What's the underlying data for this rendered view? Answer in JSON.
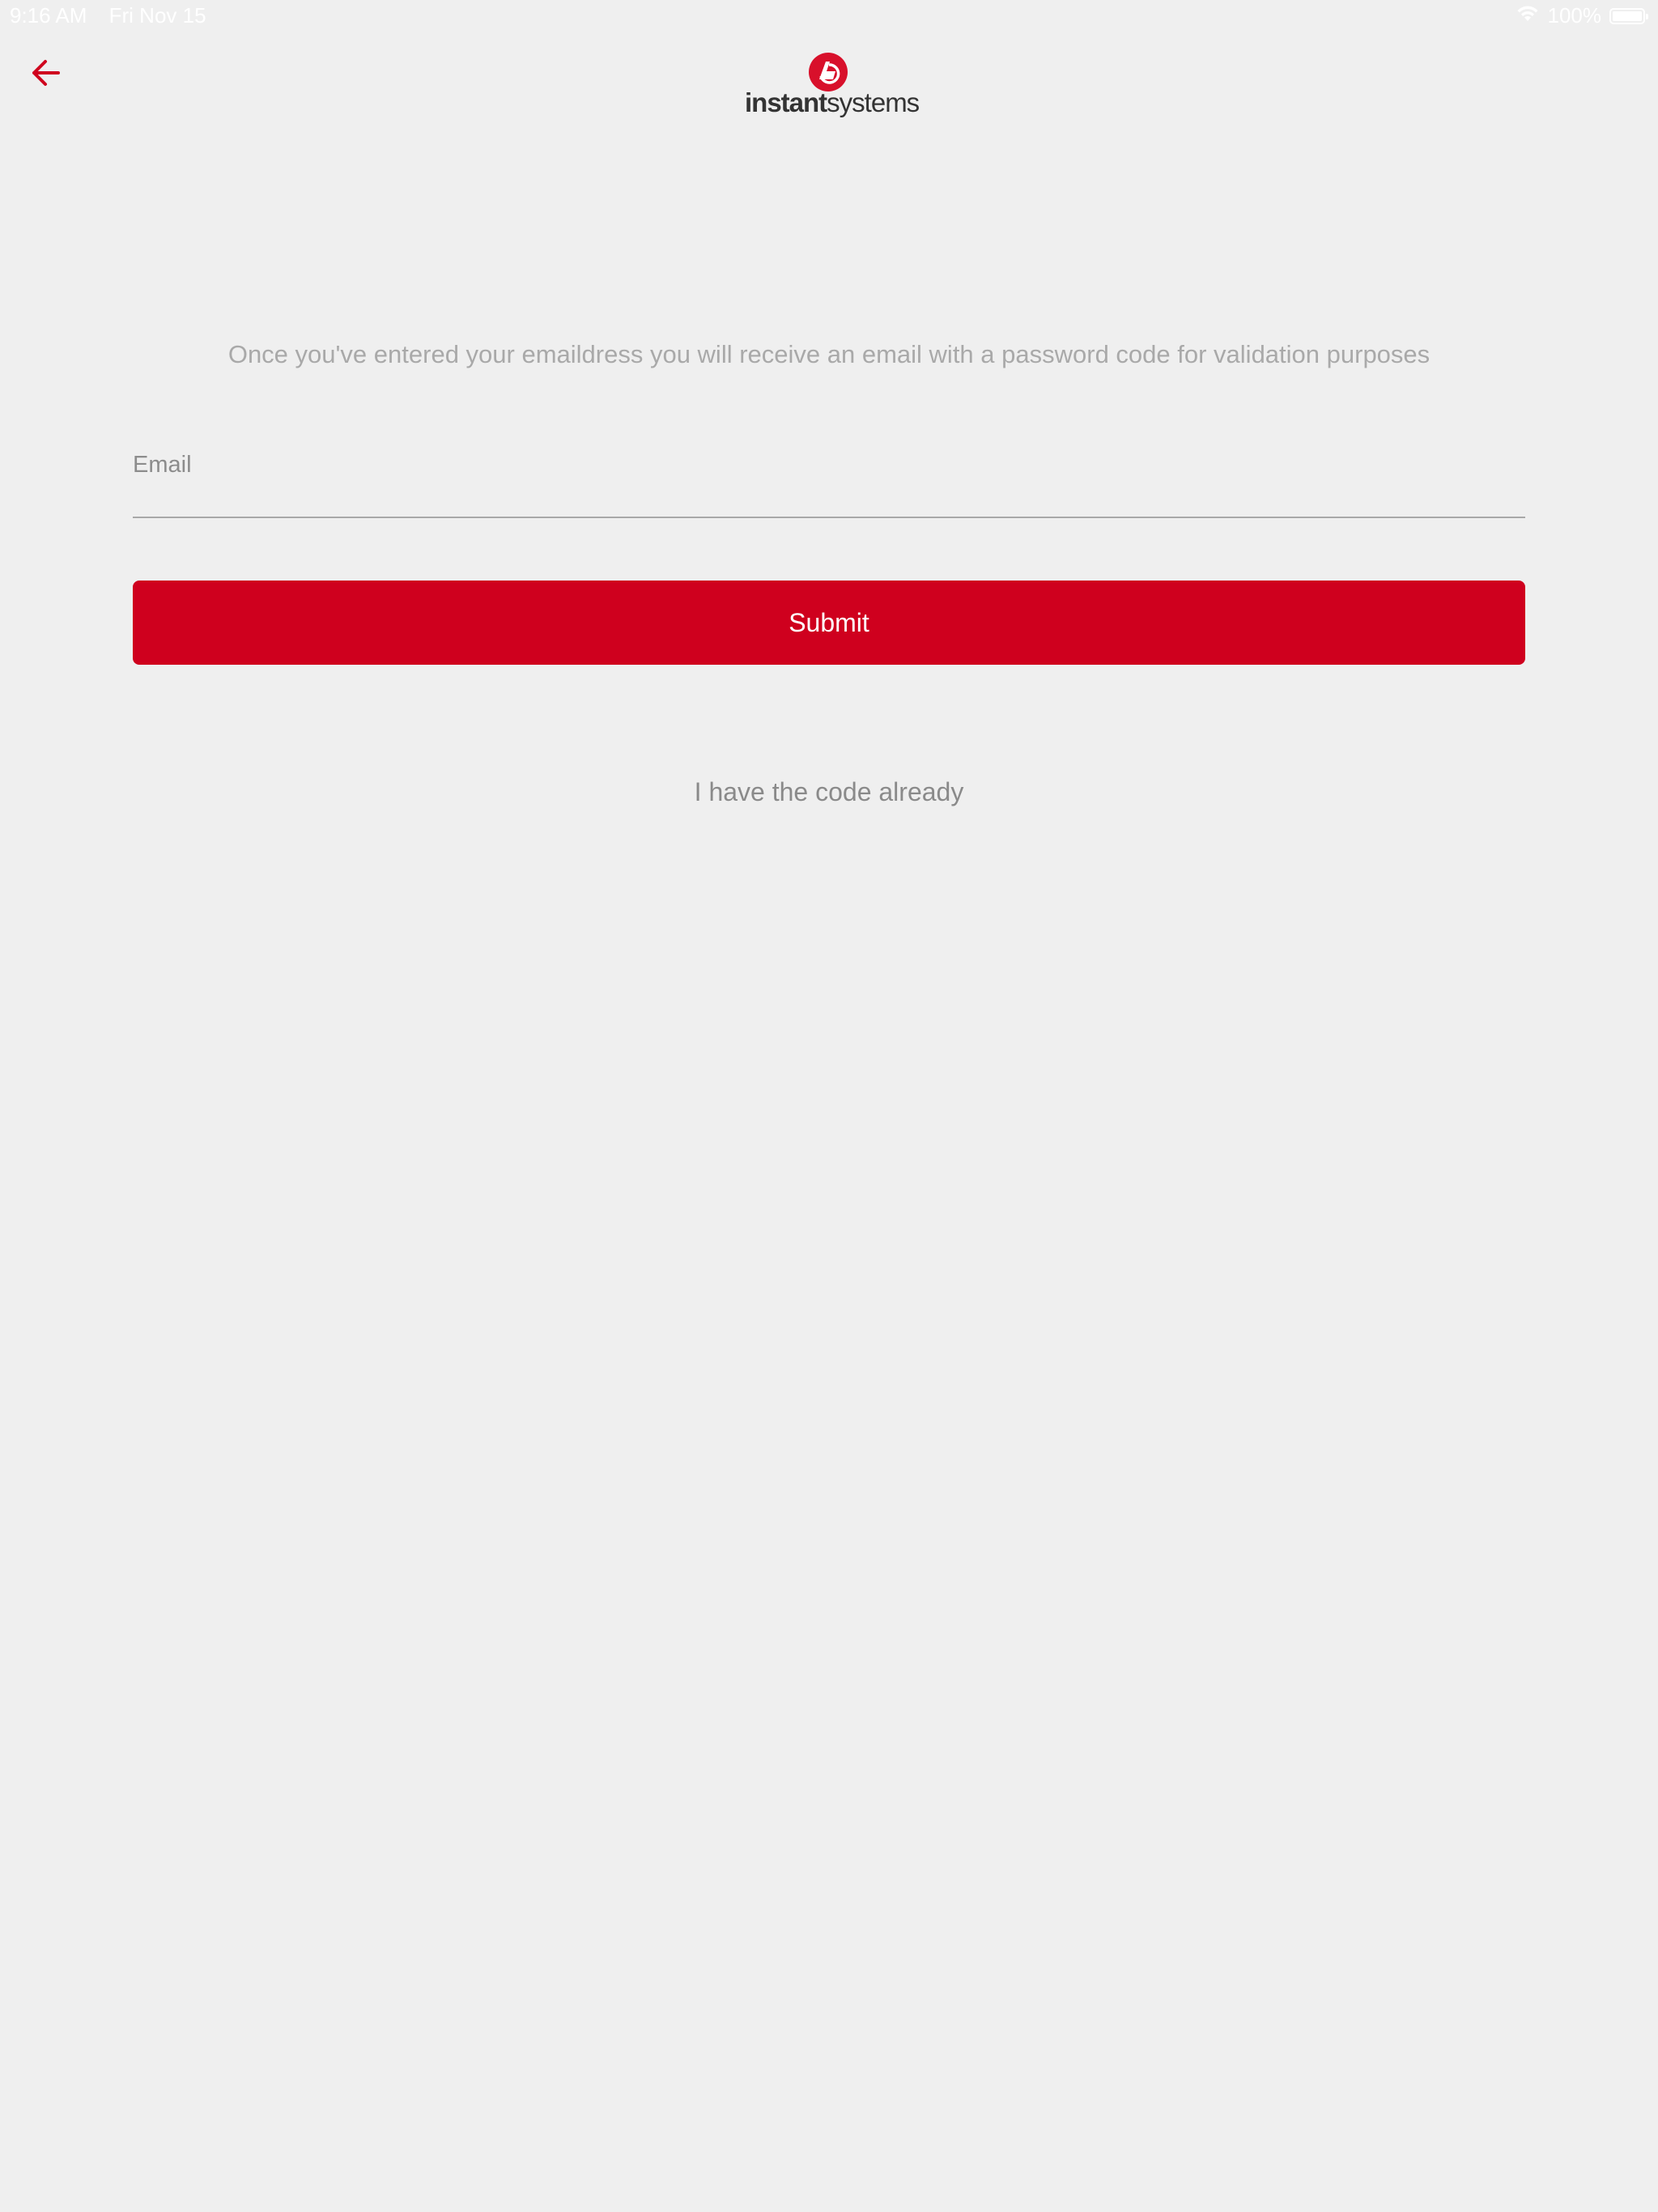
{
  "status_bar": {
    "time": "9:16 AM",
    "date": "Fri Nov 15",
    "battery_text": "100%",
    "battery_level": 1.0,
    "wifi_icon": "wifi-icon",
    "battery_icon": "battery-icon"
  },
  "header": {
    "back_icon": "arrow-left-icon",
    "logo_bold": "instant",
    "logo_light": "systems"
  },
  "form": {
    "info_text": "Once you've entered your emaildress you will receive an email with a password code for validation purposes",
    "email_placeholder": "Email",
    "email_value": "",
    "submit_label": "Submit",
    "have_code_label": "I have the code already"
  },
  "colors": {
    "accent": "#cf001e",
    "background": "#efefef",
    "muted_text": "#a9a9a9"
  }
}
